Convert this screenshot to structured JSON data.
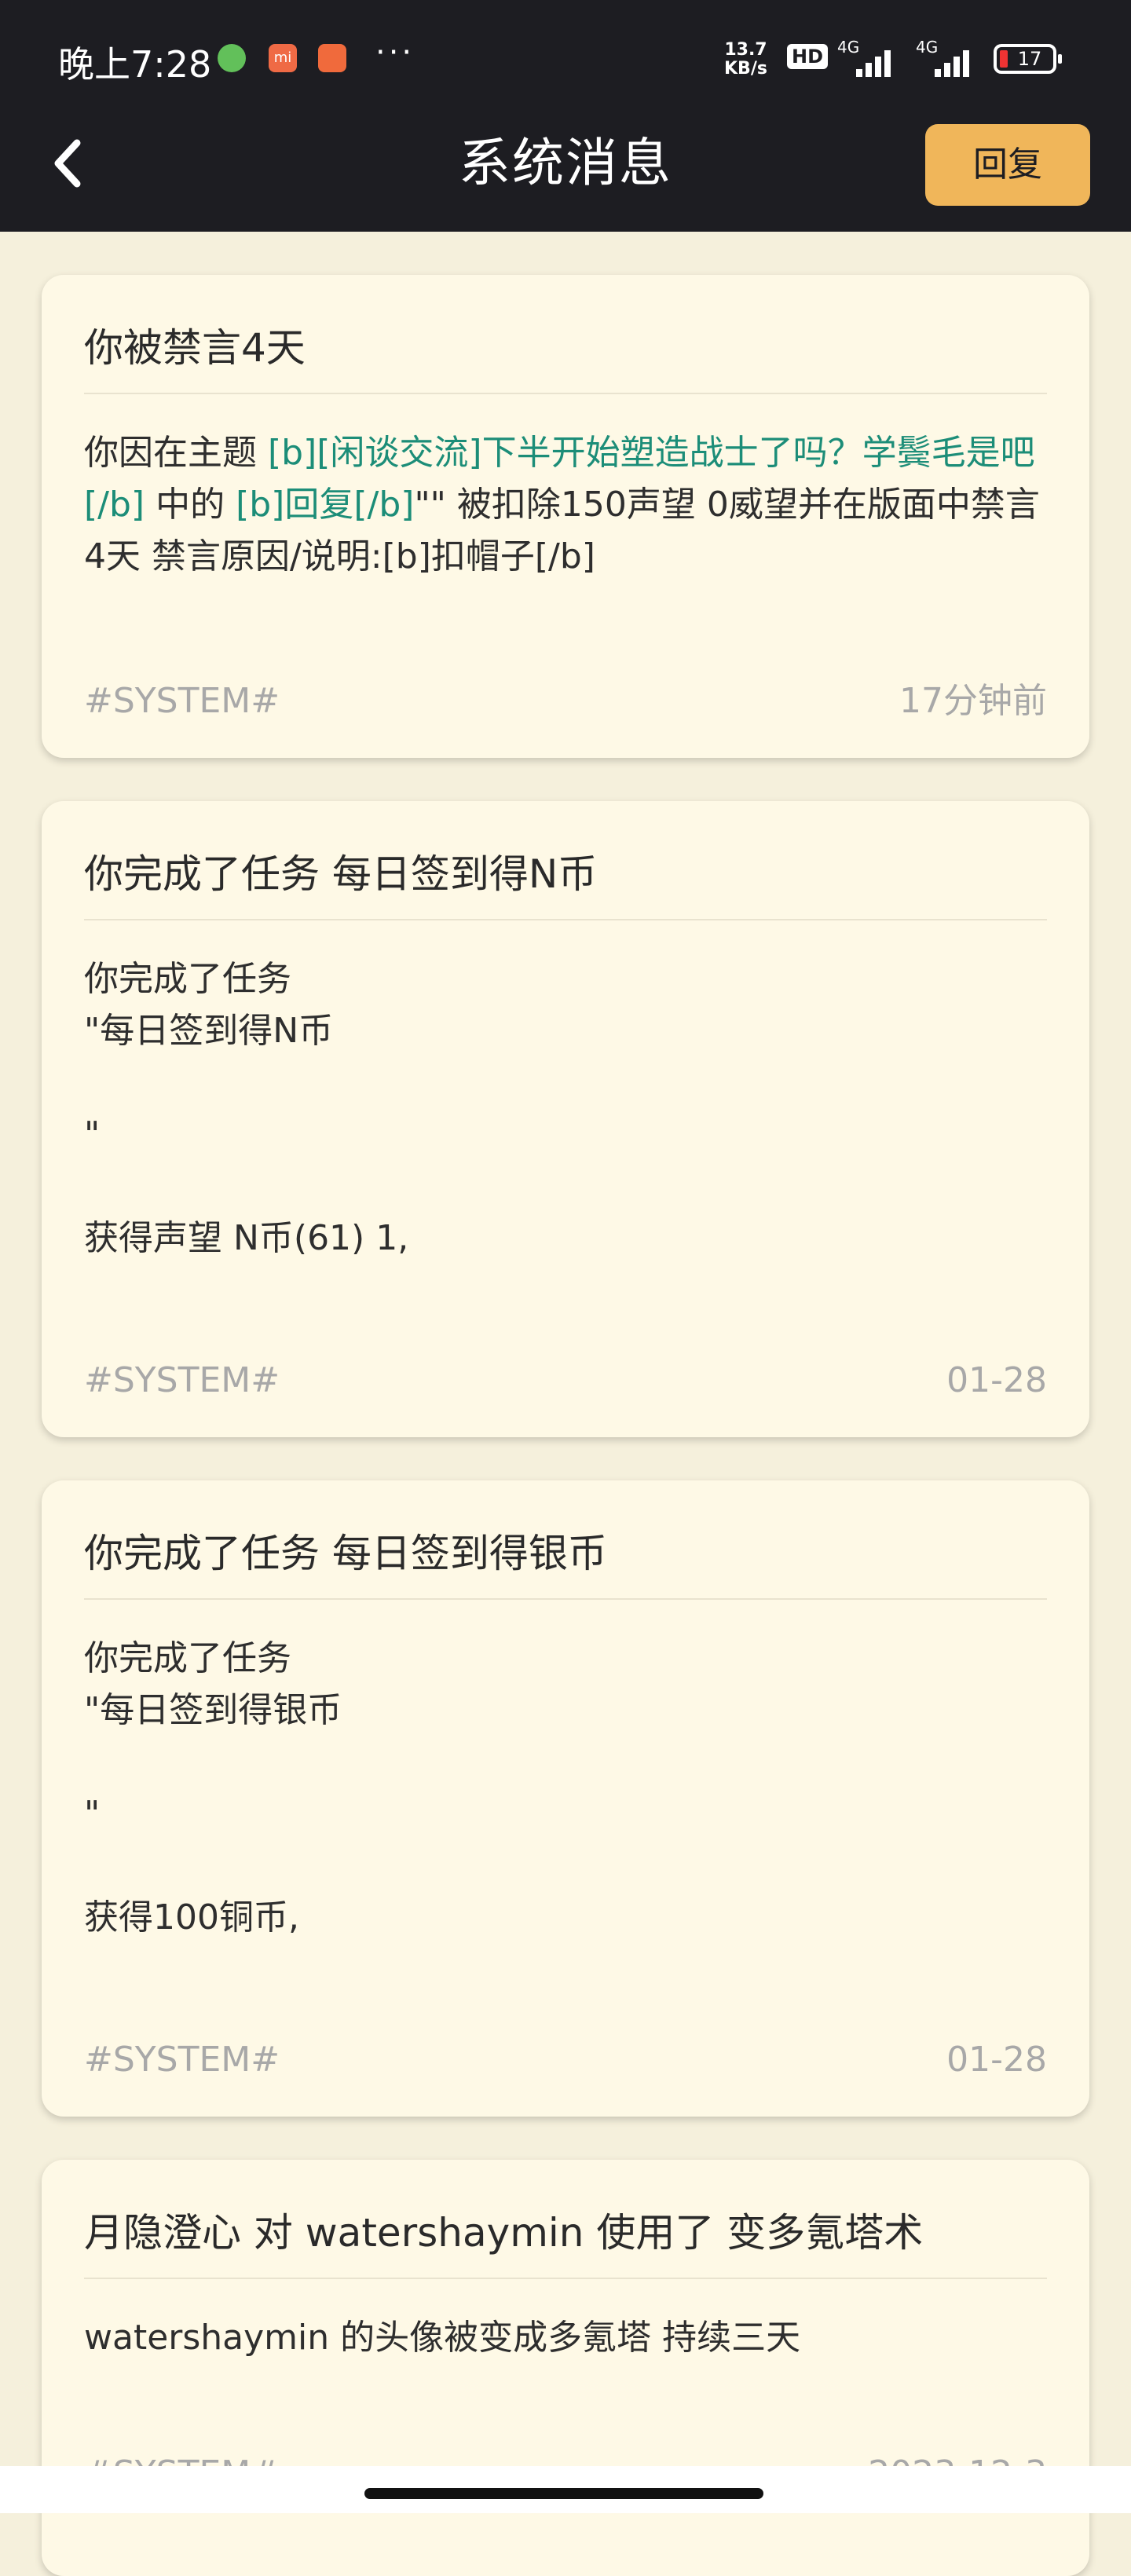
{
  "status_bar": {
    "time": "晚上7:28",
    "more": "···",
    "net_speed_value": "13.7",
    "net_speed_unit": "KB/s",
    "hd": "HD",
    "sim1": "4G",
    "sim2": "4G",
    "battery": "17",
    "icons": [
      "wechat-icon",
      "mi-store-icon",
      "shopping-bag-icon"
    ]
  },
  "header": {
    "title": "系统消息",
    "back_icon": "chevron-left-icon",
    "reply_label": "回复",
    "reply_color": "#f0b65a",
    "background": "#1d1d22"
  },
  "messages": [
    {
      "title": "你被禁言4天",
      "body_parts": [
        {
          "text": "你因在主题 ",
          "highlight": false
        },
        {
          "text": "[b][闲谈交流]下半开始塑造战士了吗？学鬓毛是吧[/b]",
          "highlight": true
        },
        {
          "text": " 中的 ",
          "highlight": false
        },
        {
          "text": "[b]回复[/b]",
          "highlight": true
        },
        {
          "text": "\"\" 被扣除150声望 0威望并在版面中禁言4天 禁言原因/说明:[b]扣帽子[/b]",
          "highlight": false
        }
      ],
      "tag": "#SYSTEM#",
      "time": "17分钟前"
    },
    {
      "title": "你完成了任务 每日签到得N币",
      "body": "你完成了任务\n\"每日签到得N币\n\n\"\n\n获得声望 N币(61) 1,",
      "tag": "#SYSTEM#",
      "time": "01-28"
    },
    {
      "title": "你完成了任务 每日签到得银币",
      "body": "你完成了任务\n\"每日签到得银币\n\n\"\n\n获得100铜币,",
      "tag": "#SYSTEM#",
      "time": "01-28"
    },
    {
      "title": "月隐澄心 对 watershaymin 使用了 变多氪塔术",
      "body": "watershaymin 的头像被变成多氪塔 持续三天",
      "tag": "#SYSTEM#",
      "time": "2023-12-3"
    }
  ],
  "colors": {
    "page_bg": "#f5f0dc",
    "card_bg": "#fef9e6",
    "link": "#1c8d78",
    "meta": "#a8a8a8"
  }
}
